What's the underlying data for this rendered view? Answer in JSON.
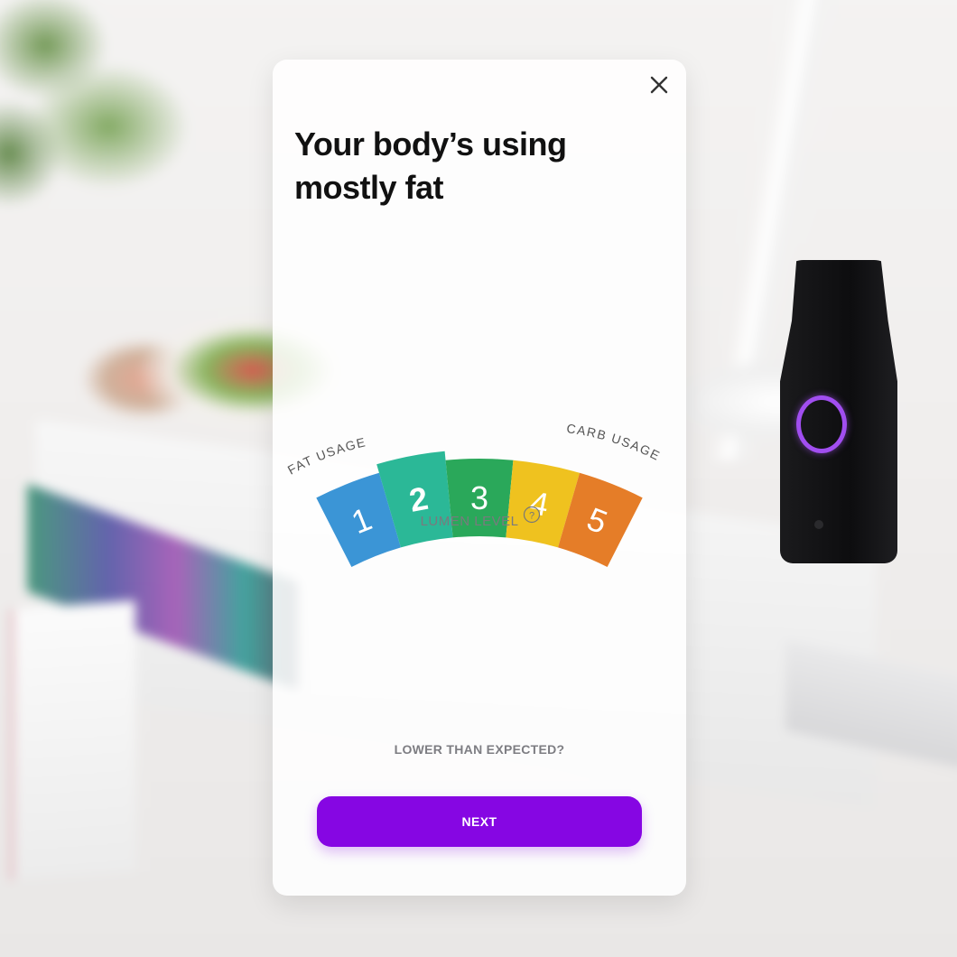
{
  "modal": {
    "title": "Your body’s using mostly fat",
    "close_icon": "close-icon"
  },
  "gauge": {
    "left_label": "FAT USAGE",
    "right_label": "CARB USAGE",
    "caption": "LUMEN LEVEL",
    "help_glyph": "?",
    "current_level": 2,
    "levels": [
      {
        "label": "1",
        "color": "#3b95d6"
      },
      {
        "label": "2",
        "color": "#2bb897"
      },
      {
        "label": "3",
        "color": "#2aa85a"
      },
      {
        "label": "4",
        "color": "#efc21f"
      },
      {
        "label": "5",
        "color": "#e57d28"
      }
    ]
  },
  "actions": {
    "lower_link": "LOWER THAN EXPECTED?",
    "next_label": "NEXT"
  },
  "colors": {
    "accent": "#8606e3",
    "device_ring": "#a14ef0"
  }
}
